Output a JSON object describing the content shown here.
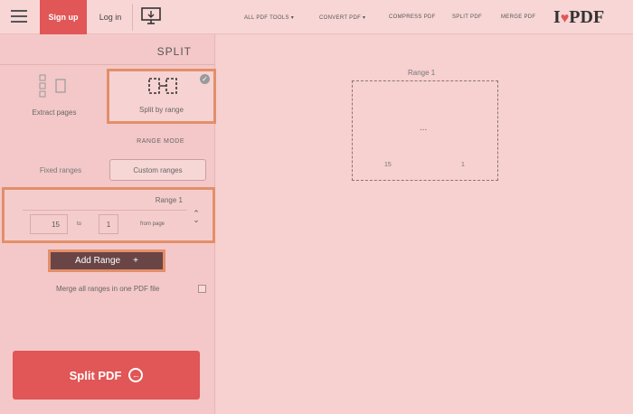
{
  "header": {
    "signup": "Sign up",
    "login": "Log in",
    "nav": [
      "ALL PDF TOOLS ▾",
      "CONVERT PDF ▾",
      "COMPRESS PDF",
      "SPLIT PDF",
      "MERGE PDF"
    ],
    "logo_i": "I",
    "logo_pdf": "PDF"
  },
  "tools": {
    "title": "SPLIT",
    "modes": {
      "split_by_range": "Split by range",
      "extract_pages": "Extract pages"
    },
    "range_mode_label": "RANGE MODE",
    "custom_ranges": "Custom ranges",
    "fixed_ranges": "Fixed ranges",
    "range": {
      "label": "Range 1",
      "from_label": "from page",
      "from_value": "1",
      "to_label": "to",
      "to_value": "15"
    },
    "add_range": "Add Range",
    "merge_label": "Merge all ranges in one PDF file",
    "split_button": "Split PDF"
  },
  "preview": {
    "label": "Range 1",
    "dots": "...",
    "page_start": "1",
    "page_end": "15"
  },
  "colors": {
    "accent": "#e15656",
    "highlight": "#e28f6a"
  }
}
